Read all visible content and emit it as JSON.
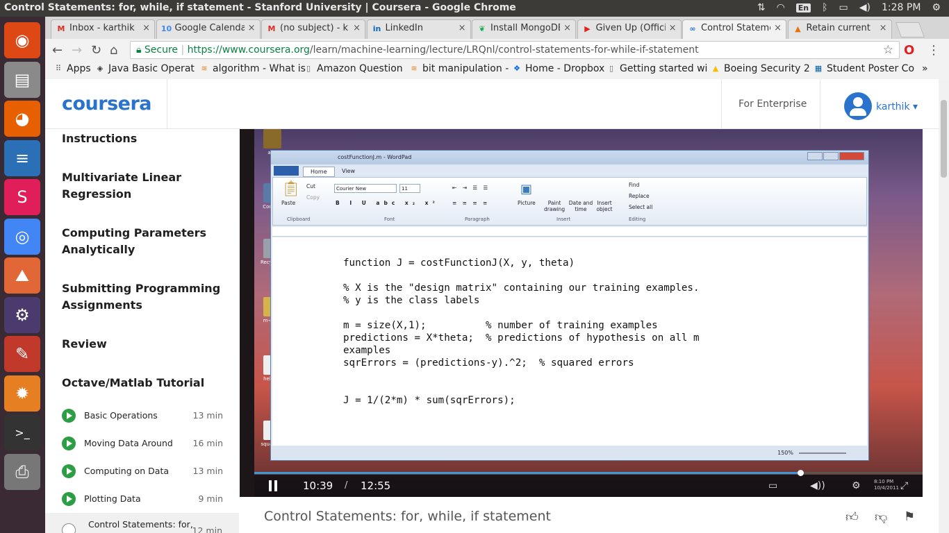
{
  "os": {
    "window_title": "Control Statements: for, while, if statement - Stanford University | Coursera - Google Chrome",
    "clock": "1:28 PM",
    "keyboard_layout": "En"
  },
  "browser": {
    "tabs": [
      {
        "label": "Inbox - karthik",
        "icon": "gmail-icon",
        "color": "#d93025",
        "glyph": "M"
      },
      {
        "label": "Google Calendar",
        "icon": "calendar-icon",
        "color": "#4285f4",
        "glyph": "10"
      },
      {
        "label": "(no subject) - k",
        "icon": "gmail-icon",
        "color": "#d93025",
        "glyph": "M"
      },
      {
        "label": "LinkedIn",
        "icon": "linkedin-icon",
        "color": "#0a66c2",
        "glyph": "in"
      },
      {
        "label": "Install MongoDB",
        "icon": "mongodb-leaf-icon",
        "color": "#13aa52",
        "glyph": "❦"
      },
      {
        "label": "Given Up (Official",
        "icon": "youtube-icon",
        "color": "#e62117",
        "glyph": "▶"
      },
      {
        "label": "Control Statements",
        "icon": "coursera-icon",
        "color": "#2a73cc",
        "glyph": "∞",
        "active": true
      },
      {
        "label": "Retain current",
        "icon": "triangle-icon",
        "color": "#e8710a",
        "glyph": "▲"
      }
    ],
    "url": {
      "secure_label": "Secure",
      "scheme_host": "https://www.coursera.org",
      "path": "/learn/machine-learning/lecture/LRQnl/control-statements-for-while-if-statement"
    },
    "bookmarks": [
      {
        "label": "Apps",
        "icon": "apps-grid-icon"
      },
      {
        "label": "Java Basic Operat",
        "icon": "diamond-icon"
      },
      {
        "label": "algorithm - What is",
        "icon": "stackoverflow-icon"
      },
      {
        "label": "Amazon Question",
        "icon": "page-icon"
      },
      {
        "label": "bit manipulation -",
        "icon": "stackoverflow-icon"
      },
      {
        "label": "Home - Dropbox",
        "icon": "dropbox-icon"
      },
      {
        "label": "Getting started wi",
        "icon": "page-icon"
      },
      {
        "label": "Boeing Security 2",
        "icon": "drive-icon"
      },
      {
        "label": "Student Poster Co",
        "icon": "ieee-icon"
      }
    ]
  },
  "coursera": {
    "logo": "coursera",
    "enterprise": "For Enterprise",
    "user": "karthik"
  },
  "sidebar": {
    "sections": [
      {
        "label": "Instructions"
      },
      {
        "label": "Multivariate Linear Regression"
      },
      {
        "label": "Computing Parameters Analytically"
      },
      {
        "label": "Submitting Programming Assignments"
      },
      {
        "label": "Review"
      },
      {
        "label": "Octave/Matlab Tutorial"
      }
    ],
    "items": [
      {
        "label": "Basic Operations",
        "duration": "13 min"
      },
      {
        "label": "Moving Data Around",
        "duration": "16 min"
      },
      {
        "label": "Computing on Data",
        "duration": "13 min"
      },
      {
        "label": "Plotting Data",
        "duration": "9 min"
      }
    ],
    "current": {
      "label": "Control Statements: for,",
      "duration": "12 min"
    }
  },
  "video": {
    "title": "Control Statements: for, while, if statement",
    "current_time": "10:39",
    "separator": "/",
    "total_time": "12:55",
    "progress_fraction": 0.817,
    "desktop_clock": "8:10 PM",
    "desktop_date": "10/4/2011",
    "desktop_icons": [
      "ang",
      "Comput",
      "Recycle B",
      "m-class",
      "hello.m",
      "squareAn"
    ],
    "wordpad": {
      "title": "costFunctionJ.m - WordPad",
      "tabs": [
        "Home",
        "View"
      ],
      "font": "Courier New",
      "size": "11",
      "groups": [
        "Clipboard",
        "Font",
        "Paragraph",
        "Insert",
        "Editing"
      ],
      "clipboard": [
        "Paste",
        "Cut",
        "Copy"
      ],
      "insert": [
        "Picture",
        "Paint drawing",
        "Date and time",
        "Insert object"
      ],
      "editing": [
        "Find",
        "Replace",
        "Select all"
      ],
      "zoom": "150%",
      "code": "function J = costFunctionJ(X, y, theta)\n\n% X is the \"design matrix\" containing our training examples.\n% y is the class labels\n\nm = size(X,1);          % number of training examples\npredictions = X*theta;  % predictions of hypothesis on all m\nexamples\nsqrErrors = (predictions-y).^2;  % squared errors\n\n\nJ = 1/(2*m) * sum(sqrErrors);"
    }
  },
  "launcher": [
    {
      "name": "ubuntu-icon",
      "color": "#dd4814",
      "glyph": "◉"
    },
    {
      "name": "files-icon",
      "color": "#8a8a8a",
      "glyph": "▤"
    },
    {
      "name": "firefox-icon",
      "color": "#e66000",
      "glyph": "◕"
    },
    {
      "name": "writer-icon",
      "color": "#2b6fb6",
      "glyph": "≡"
    },
    {
      "name": "slack-icon",
      "color": "#e01e5a",
      "glyph": "S"
    },
    {
      "name": "chrome-icon",
      "color": "#4285f4",
      "glyph": "◎"
    },
    {
      "name": "matlab-icon",
      "color": "#e16737",
      "glyph": "⛰"
    },
    {
      "name": "eclipse-icon",
      "color": "#4b3a6e",
      "glyph": "⚙"
    },
    {
      "name": "tools-icon",
      "color": "#c0392b",
      "glyph": "✎"
    },
    {
      "name": "settings-icon",
      "color": "#e67e22",
      "glyph": "✹"
    },
    {
      "name": "terminal-icon",
      "color": "#333333",
      "glyph": ">_"
    },
    {
      "name": "printer-icon",
      "color": "#777777",
      "glyph": "⎙"
    }
  ]
}
